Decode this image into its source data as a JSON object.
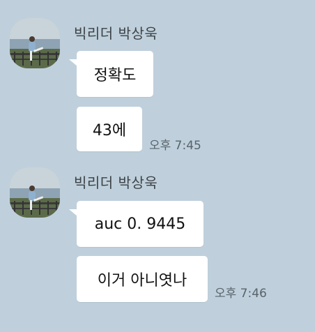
{
  "chat": {
    "groups": [
      {
        "sender": "빅리더 박상욱",
        "messages": [
          "정확도",
          "43에"
        ],
        "time": "오후 7:45"
      },
      {
        "sender": "빅리더 박상욱",
        "messages": [
          "auc 0. 9445",
          "이거 아니엿나"
        ],
        "time": "오후 7:46"
      }
    ]
  },
  "colors": {
    "background": "#bfd0dc",
    "bubble": "#ffffff",
    "name_text": "#3c4146",
    "time_text": "#58636b"
  },
  "icons": {
    "avatar": "profile-photo-person-at-seaside-railing"
  }
}
